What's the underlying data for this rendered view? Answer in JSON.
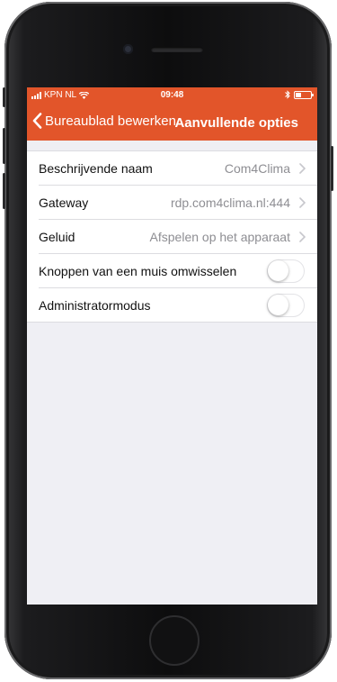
{
  "status": {
    "carrier": "KPN NL",
    "time": "09:48",
    "battery_level": 0.35
  },
  "nav": {
    "back_label": "Bureaublad bewerken",
    "title": "Aanvullende opties"
  },
  "rows": [
    {
      "label": "Beschrijvende naam",
      "value": "Com4Clima"
    },
    {
      "label": "Gateway",
      "value": "rdp.com4clima.nl:444"
    },
    {
      "label": "Geluid",
      "value": "Afspelen op het apparaat"
    },
    {
      "label": "Knoppen van een muis omwisselen",
      "toggle": false
    },
    {
      "label": "Administratormodus",
      "toggle": false
    }
  ],
  "colors": {
    "accent": "#e2552a",
    "background": "#efeff4",
    "secondary_text": "#8e8e93"
  }
}
